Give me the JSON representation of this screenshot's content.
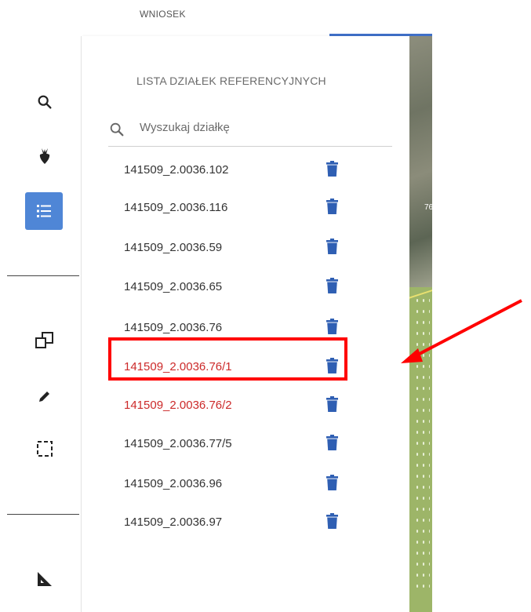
{
  "header": {
    "tab_label": "WNIOSEK"
  },
  "toolbar": {
    "tools": [
      {
        "name": "search-tool",
        "icon": "search-icon"
      },
      {
        "name": "crop-tool",
        "icon": "beet-icon"
      },
      {
        "name": "list-tool",
        "icon": "list-icon",
        "active": true
      },
      {
        "name": "copy-tool",
        "icon": "copy-icon"
      },
      {
        "name": "edit-tool",
        "icon": "pencil-icon"
      },
      {
        "name": "select-tool",
        "icon": "select-rect-icon"
      },
      {
        "name": "measure-tool",
        "icon": "ruler-triangle-icon"
      }
    ]
  },
  "panel": {
    "title": "LISTA DZIAŁEK REFERENCYJNYCH",
    "search_placeholder": "Wyszukaj działkę",
    "parcels": [
      {
        "id": "141509_2.0036.102",
        "status": "normal"
      },
      {
        "id": "141509_2.0036.116",
        "status": "normal"
      },
      {
        "id": "141509_2.0036.59",
        "status": "normal"
      },
      {
        "id": "141509_2.0036.65",
        "status": "normal"
      },
      {
        "id": "141509_2.0036.76",
        "status": "highlighted"
      },
      {
        "id": "141509_2.0036.76/1",
        "status": "error"
      },
      {
        "id": "141509_2.0036.76/2",
        "status": "error"
      },
      {
        "id": "141509_2.0036.77/5",
        "status": "normal"
      },
      {
        "id": "141509_2.0036.96",
        "status": "normal"
      },
      {
        "id": "141509_2.0036.97",
        "status": "normal"
      }
    ]
  },
  "map": {
    "label": "76"
  },
  "colors": {
    "accent": "#4f86d6",
    "error_text": "#cc2a2a",
    "trash": "#2f5fb3",
    "annotation": "#ff0000"
  }
}
